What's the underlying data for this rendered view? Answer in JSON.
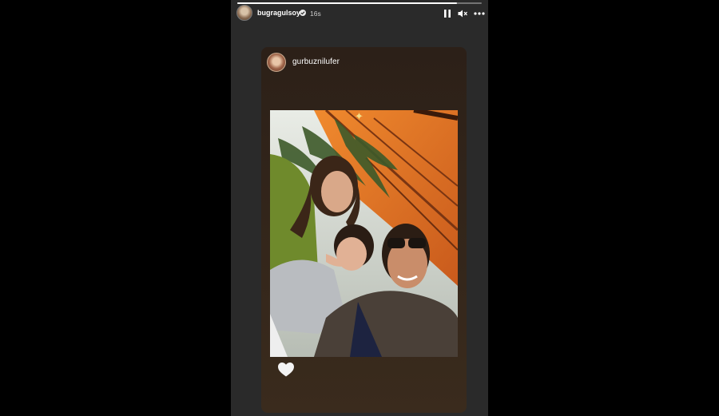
{
  "story": {
    "author": "bugragulsoy",
    "verified": true,
    "timestamp": "16s",
    "progress": 0.9,
    "controls": {
      "pause": "pause-icon",
      "mute": "mute-icon",
      "more": "more-icon"
    }
  },
  "shared_post": {
    "author": "gurbuznilufer",
    "reaction": "heart-icon"
  },
  "colors": {
    "background": "#000000",
    "story_bg": "#2a2a2a",
    "card_bg": "#332519",
    "accent_orange": "#e8742a"
  }
}
